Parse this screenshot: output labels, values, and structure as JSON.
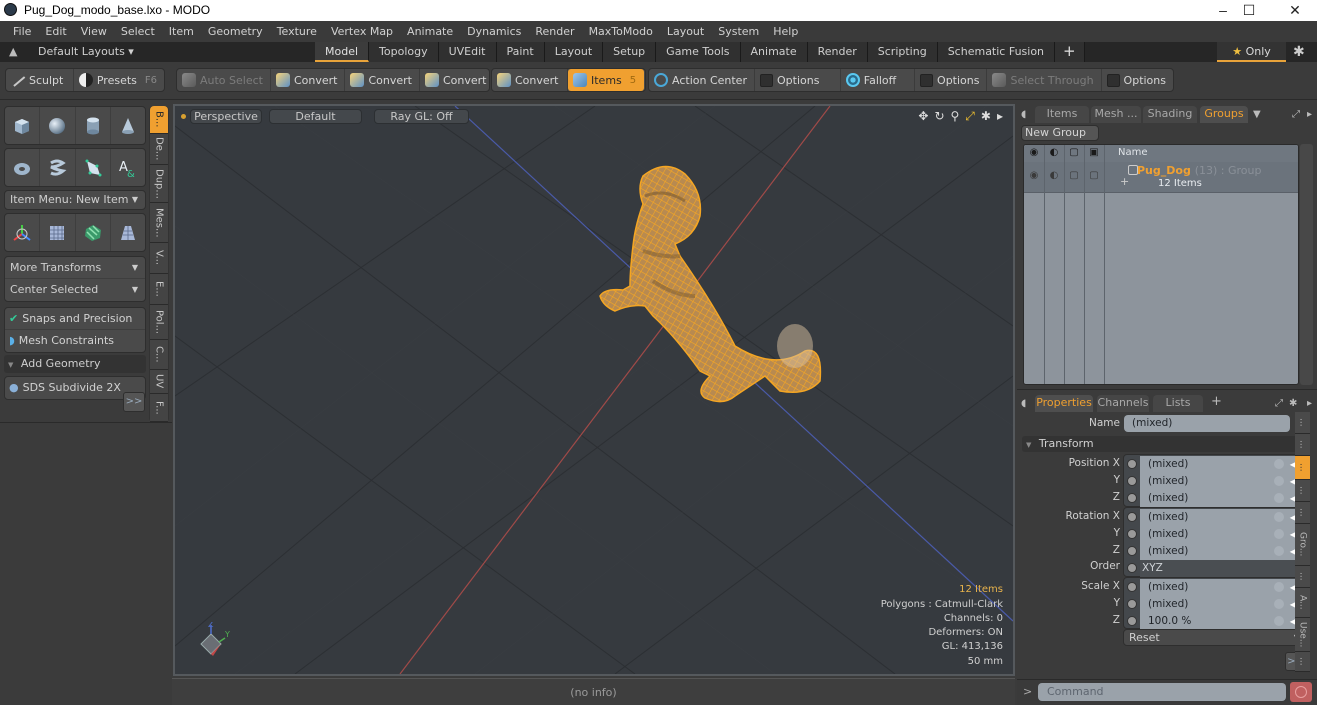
{
  "window": {
    "title": "Pug_Dog_modo_base.lxo - MODO",
    "controls": {
      "minimize": "–",
      "maximize": "☐",
      "close": "✕"
    }
  },
  "menu": [
    "File",
    "Edit",
    "View",
    "Select",
    "Item",
    "Geometry",
    "Texture",
    "Vertex Map",
    "Animate",
    "Dynamics",
    "Render",
    "MaxToModo",
    "Layout",
    "System",
    "Help"
  ],
  "layout_bar": {
    "default_layouts": "Default Layouts ▾",
    "tabs": [
      "Model",
      "Topology",
      "UVEdit",
      "Paint",
      "Layout",
      "Setup",
      "Game Tools",
      "Animate",
      "Render",
      "Scripting",
      "Schematic Fusion"
    ],
    "active_tab": "Model",
    "add_tab": "+",
    "only_label": "Only",
    "star": "★",
    "gear": "✱"
  },
  "toolbar": {
    "sculpt": "Sculpt",
    "presets": "Presets",
    "presets_key": "F6",
    "auto_select": "Auto Select",
    "convert1": "Convert",
    "convert2": "Convert",
    "convert3": "Convert",
    "convert4": "Convert",
    "items": "Items",
    "items_key": "5",
    "action_center": "Action Center",
    "options1": "Options",
    "falloff": "Falloff",
    "options2": "Options",
    "select_through": "Select Through",
    "options3": "Options"
  },
  "left_panel": {
    "primitives_row1": [
      "cube-icon",
      "sphere-icon",
      "cylinder-icon",
      "cone-icon"
    ],
    "primitives_row2": [
      "torus-icon",
      "capsule-icon",
      "pen-polygon-icon",
      "text-icon"
    ],
    "item_menu": "Item Menu: New Item",
    "transform_row": [
      "transform-gizmo-icon",
      "grid-plane-icon",
      "checker-cube-icon",
      "wedge-icon"
    ],
    "more_transforms": "More Transforms",
    "center_selected": "Center Selected",
    "snaps": "Snaps and Precision",
    "mesh_constraints": "Mesh Constraints",
    "add_geometry": "Add Geometry",
    "sds_subdivide": "SDS Subdivide 2X",
    "more": ">>",
    "vtabs": [
      "B...",
      "De...",
      "Dup...",
      "Mes...",
      "V...",
      "E...",
      "Pol...",
      "C...",
      "UV",
      "F..."
    ],
    "active_vtab": "B..."
  },
  "viewport": {
    "view": "Perspective",
    "style": "Default",
    "raygl": "Ray GL: Off",
    "icons": [
      "move-view-icon",
      "rotate-view-icon",
      "zoom-view-icon",
      "maximize-view-icon",
      "settings-icon",
      "expand-arrow-icon"
    ],
    "info": {
      "items": "12 Items",
      "polygons": "Polygons : Catmull-Clark",
      "channels": "Channels: 0",
      "deformers": "Deformers: ON",
      "gl": "GL: 413,136",
      "scale": "50 mm"
    },
    "axes": {
      "z": "Z",
      "y": "Y"
    },
    "selection_color": "#f0a030"
  },
  "status": {
    "info": "(no info)"
  },
  "groups_panel": {
    "tabs": [
      "Items",
      "Mesh ...",
      "Shading",
      "Groups"
    ],
    "active_tab": "Groups",
    "new_group": "New Group",
    "column_name": "Name",
    "group": {
      "name": "Pug_Dog",
      "meta": "(13) : Group",
      "sub": "12 Items"
    }
  },
  "properties_panel": {
    "tabs": [
      "Properties",
      "Channels",
      "Lists",
      "+"
    ],
    "active_tab": "Properties",
    "name_label": "Name",
    "name_value": "(mixed)",
    "transform_header": "Transform",
    "position": {
      "label": "Position X",
      "x": "(mixed)",
      "y": "(mixed)",
      "z": "(mixed)"
    },
    "rotation": {
      "label": "Rotation X",
      "x": "(mixed)",
      "y": "(mixed)",
      "z": "(mixed)"
    },
    "order": {
      "label": "Order",
      "value": "XYZ"
    },
    "scale": {
      "label": "Scale X",
      "x": "(mixed)",
      "y": "(mixed)",
      "z": "100.0 %"
    },
    "axis_y": "Y",
    "axis_z": "Z",
    "reset": "Reset",
    "more": ">>",
    "vtabs": [
      "...",
      "...",
      "...",
      "...",
      "...",
      "Gro...",
      "...",
      "A...",
      "Use...",
      "..."
    ]
  },
  "command": {
    "prompt": ">",
    "placeholder": "Command"
  }
}
